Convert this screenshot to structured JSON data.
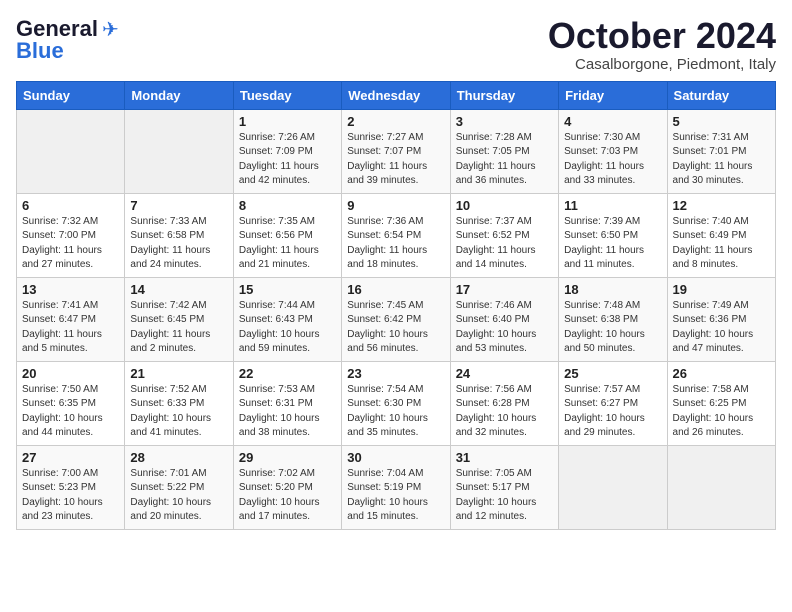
{
  "header": {
    "logo_line1": "General",
    "logo_line2": "Blue",
    "month_title": "October 2024",
    "subtitle": "Casalborgone, Piedmont, Italy"
  },
  "days_of_week": [
    "Sunday",
    "Monday",
    "Tuesday",
    "Wednesday",
    "Thursday",
    "Friday",
    "Saturday"
  ],
  "weeks": [
    [
      {
        "day": "",
        "info": ""
      },
      {
        "day": "",
        "info": ""
      },
      {
        "day": "1",
        "info": "Sunrise: 7:26 AM\nSunset: 7:09 PM\nDaylight: 11 hours and 42 minutes."
      },
      {
        "day": "2",
        "info": "Sunrise: 7:27 AM\nSunset: 7:07 PM\nDaylight: 11 hours and 39 minutes."
      },
      {
        "day": "3",
        "info": "Sunrise: 7:28 AM\nSunset: 7:05 PM\nDaylight: 11 hours and 36 minutes."
      },
      {
        "day": "4",
        "info": "Sunrise: 7:30 AM\nSunset: 7:03 PM\nDaylight: 11 hours and 33 minutes."
      },
      {
        "day": "5",
        "info": "Sunrise: 7:31 AM\nSunset: 7:01 PM\nDaylight: 11 hours and 30 minutes."
      }
    ],
    [
      {
        "day": "6",
        "info": "Sunrise: 7:32 AM\nSunset: 7:00 PM\nDaylight: 11 hours and 27 minutes."
      },
      {
        "day": "7",
        "info": "Sunrise: 7:33 AM\nSunset: 6:58 PM\nDaylight: 11 hours and 24 minutes."
      },
      {
        "day": "8",
        "info": "Sunrise: 7:35 AM\nSunset: 6:56 PM\nDaylight: 11 hours and 21 minutes."
      },
      {
        "day": "9",
        "info": "Sunrise: 7:36 AM\nSunset: 6:54 PM\nDaylight: 11 hours and 18 minutes."
      },
      {
        "day": "10",
        "info": "Sunrise: 7:37 AM\nSunset: 6:52 PM\nDaylight: 11 hours and 14 minutes."
      },
      {
        "day": "11",
        "info": "Sunrise: 7:39 AM\nSunset: 6:50 PM\nDaylight: 11 hours and 11 minutes."
      },
      {
        "day": "12",
        "info": "Sunrise: 7:40 AM\nSunset: 6:49 PM\nDaylight: 11 hours and 8 minutes."
      }
    ],
    [
      {
        "day": "13",
        "info": "Sunrise: 7:41 AM\nSunset: 6:47 PM\nDaylight: 11 hours and 5 minutes."
      },
      {
        "day": "14",
        "info": "Sunrise: 7:42 AM\nSunset: 6:45 PM\nDaylight: 11 hours and 2 minutes."
      },
      {
        "day": "15",
        "info": "Sunrise: 7:44 AM\nSunset: 6:43 PM\nDaylight: 10 hours and 59 minutes."
      },
      {
        "day": "16",
        "info": "Sunrise: 7:45 AM\nSunset: 6:42 PM\nDaylight: 10 hours and 56 minutes."
      },
      {
        "day": "17",
        "info": "Sunrise: 7:46 AM\nSunset: 6:40 PM\nDaylight: 10 hours and 53 minutes."
      },
      {
        "day": "18",
        "info": "Sunrise: 7:48 AM\nSunset: 6:38 PM\nDaylight: 10 hours and 50 minutes."
      },
      {
        "day": "19",
        "info": "Sunrise: 7:49 AM\nSunset: 6:36 PM\nDaylight: 10 hours and 47 minutes."
      }
    ],
    [
      {
        "day": "20",
        "info": "Sunrise: 7:50 AM\nSunset: 6:35 PM\nDaylight: 10 hours and 44 minutes."
      },
      {
        "day": "21",
        "info": "Sunrise: 7:52 AM\nSunset: 6:33 PM\nDaylight: 10 hours and 41 minutes."
      },
      {
        "day": "22",
        "info": "Sunrise: 7:53 AM\nSunset: 6:31 PM\nDaylight: 10 hours and 38 minutes."
      },
      {
        "day": "23",
        "info": "Sunrise: 7:54 AM\nSunset: 6:30 PM\nDaylight: 10 hours and 35 minutes."
      },
      {
        "day": "24",
        "info": "Sunrise: 7:56 AM\nSunset: 6:28 PM\nDaylight: 10 hours and 32 minutes."
      },
      {
        "day": "25",
        "info": "Sunrise: 7:57 AM\nSunset: 6:27 PM\nDaylight: 10 hours and 29 minutes."
      },
      {
        "day": "26",
        "info": "Sunrise: 7:58 AM\nSunset: 6:25 PM\nDaylight: 10 hours and 26 minutes."
      }
    ],
    [
      {
        "day": "27",
        "info": "Sunrise: 7:00 AM\nSunset: 5:23 PM\nDaylight: 10 hours and 23 minutes."
      },
      {
        "day": "28",
        "info": "Sunrise: 7:01 AM\nSunset: 5:22 PM\nDaylight: 10 hours and 20 minutes."
      },
      {
        "day": "29",
        "info": "Sunrise: 7:02 AM\nSunset: 5:20 PM\nDaylight: 10 hours and 17 minutes."
      },
      {
        "day": "30",
        "info": "Sunrise: 7:04 AM\nSunset: 5:19 PM\nDaylight: 10 hours and 15 minutes."
      },
      {
        "day": "31",
        "info": "Sunrise: 7:05 AM\nSunset: 5:17 PM\nDaylight: 10 hours and 12 minutes."
      },
      {
        "day": "",
        "info": ""
      },
      {
        "day": "",
        "info": ""
      }
    ]
  ]
}
